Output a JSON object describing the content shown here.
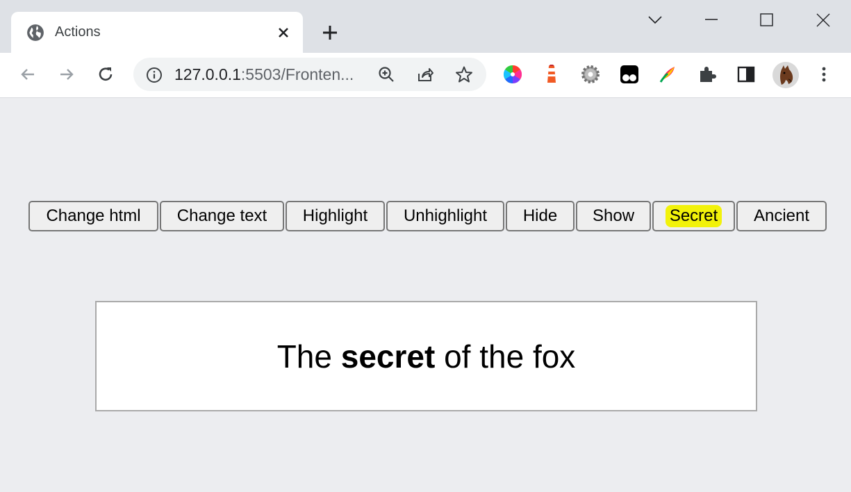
{
  "browser": {
    "tab": {
      "title": "Actions",
      "favicon": "globe-icon"
    },
    "address": {
      "host": "127.0.0.1",
      "rest": ":5503/Fronten..."
    },
    "toolbar_icons": [
      "back-arrow-icon",
      "forward-arrow-icon",
      "reload-icon",
      "zoom-icon",
      "share-icon",
      "bookmark-star-icon"
    ],
    "extensions": [
      "color-wheel-icon",
      "lighthouse-icon",
      "gear-extension-icon",
      "tampermonkey-icon",
      "feather-extension-icon",
      "puzzle-extensions-icon",
      "side-panel-icon",
      "profile-avatar-icon",
      "menu-kebab-icon"
    ]
  },
  "buttons": [
    {
      "label": "Change html",
      "highlighted": false
    },
    {
      "label": "Change text",
      "highlighted": false
    },
    {
      "label": "Highlight",
      "highlighted": false
    },
    {
      "label": "Unhighlight",
      "highlighted": false
    },
    {
      "label": "Hide",
      "highlighted": false
    },
    {
      "label": "Show",
      "highlighted": false
    },
    {
      "label": "Secret",
      "highlighted": true
    },
    {
      "label": "Ancient",
      "highlighted": false
    }
  ],
  "content": {
    "text_before": "The ",
    "text_bold": "secret",
    "text_after": " of the fox"
  },
  "colors": {
    "highlight": "#f2f20a",
    "page_bg": "#ecedf0"
  }
}
